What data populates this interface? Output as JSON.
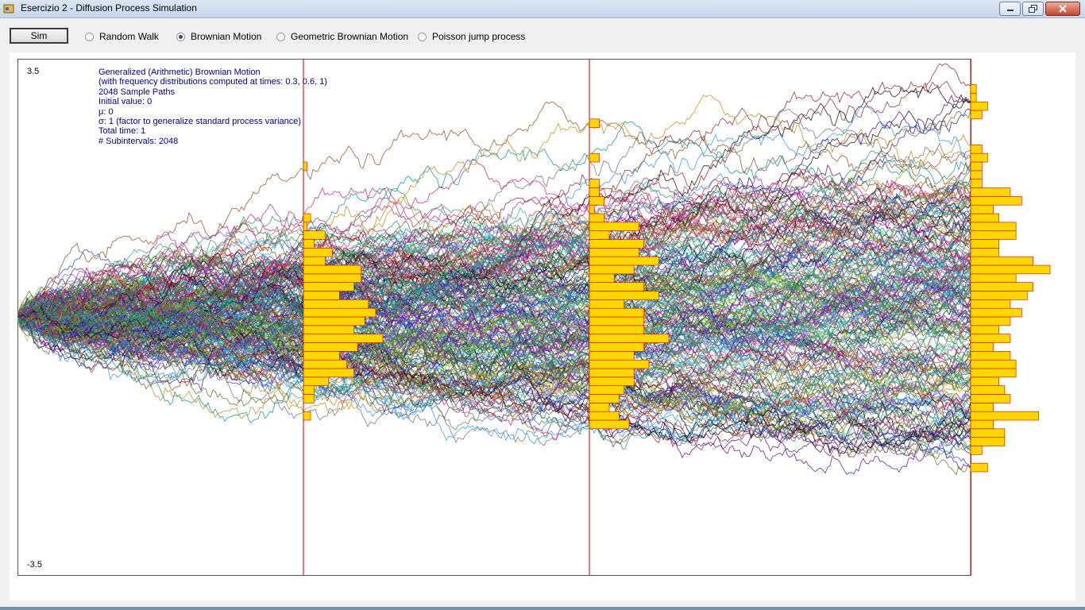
{
  "window": {
    "title": "Esercizio 2 - Diffusion Process Simulation",
    "icons": [
      "app-icon",
      "minimize-icon",
      "restore-icon",
      "close-icon"
    ]
  },
  "toolbar": {
    "sim_label": "Sim",
    "options": [
      {
        "label": "Random Walk",
        "selected": false
      },
      {
        "label": "Brownian Motion",
        "selected": true
      },
      {
        "label": "Geometric Brownian Motion",
        "selected": false
      },
      {
        "label": "Poisson jump process",
        "selected": false
      }
    ]
  },
  "plot": {
    "y_max_label": "3.5",
    "y_min_label": "-3.5",
    "info_lines": [
      "Generalized (Arithmetic) Brownian Motion",
      "(with frequency distributions computed at times: 0.3, 0.6, 1)",
      "2048 Sample Paths",
      "Initial value: 0",
      "μ: 0",
      "σ: 1 (factor to generalize standard process variance)",
      "Total time: 1",
      "# Subintervals: 2048"
    ],
    "colors": {
      "marker_line": "#d40000",
      "histogram_fill": "#ffd700",
      "histogram_edge": "#d40000",
      "info_text": "#000080"
    }
  },
  "chart_data": {
    "type": "line",
    "ylim": [
      -3.5,
      3.5
    ],
    "xlim": [
      0,
      1
    ],
    "marker_times": [
      0.3,
      0.6,
      1
    ],
    "sample_paths": 2048,
    "initial_value": 0,
    "mu": 0,
    "sigma": 1,
    "total_time": 1,
    "subintervals": 2048
  }
}
